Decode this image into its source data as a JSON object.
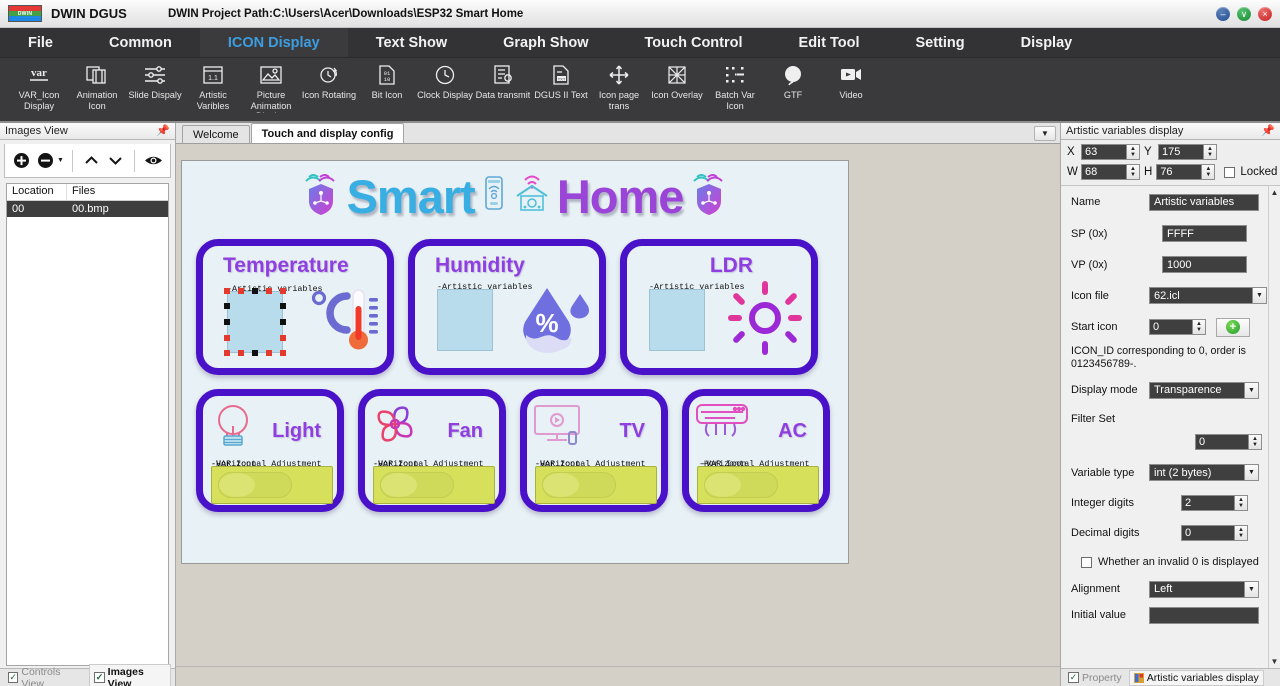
{
  "titlebar": {
    "logo_text": "DWIN",
    "app_name": "DWIN DGUS",
    "project_path": "DWIN Project Path:C:\\Users\\Acer\\Downloads\\ESP32 Smart Home",
    "minimize": "–",
    "maximize": "∨",
    "close": "×"
  },
  "menubar": {
    "items": [
      {
        "label": "File",
        "active": false
      },
      {
        "label": "Common",
        "active": false
      },
      {
        "label": "ICON Display",
        "active": true
      },
      {
        "label": "Text Show",
        "active": false
      },
      {
        "label": "Graph Show",
        "active": false
      },
      {
        "label": "Touch Control",
        "active": false
      },
      {
        "label": "Edit Tool",
        "active": false
      },
      {
        "label": "Setting",
        "active": false
      },
      {
        "label": "Display",
        "active": false
      }
    ],
    "active_color": "#3c9ee0"
  },
  "ribbon": {
    "items": [
      {
        "label": "VAR_Icon Display",
        "icon": "var-text-icon"
      },
      {
        "label": "Animation Icon",
        "icon": "animation-frames-icon"
      },
      {
        "label": "Slide Dispaly",
        "icon": "sliders-icon"
      },
      {
        "label": "Artistic Varibles",
        "icon": "artistic-variable-icon"
      },
      {
        "label": "Picture Animation Display",
        "icon": "picture-animation-icon"
      },
      {
        "label": "Icon Rotating",
        "icon": "icon-rotate-icon"
      },
      {
        "label": "Bit Icon",
        "icon": "bit-icon"
      },
      {
        "label": "Clock Display",
        "icon": "clock-icon"
      },
      {
        "label": "Data transmit",
        "icon": "data-transmit-icon"
      },
      {
        "label": "DGUS II Text",
        "icon": "dgus-text-icon"
      },
      {
        "label": "Icon page trans",
        "icon": "move-arrows-icon"
      },
      {
        "label": "Icon Overlay",
        "icon": "icon-overlay-icon"
      },
      {
        "label": "Batch Var Icon",
        "icon": "batch-var-icon"
      },
      {
        "label": "GTF",
        "icon": "gtf-circle-icon"
      },
      {
        "label": "Video",
        "icon": "video-icon"
      }
    ]
  },
  "left_panel": {
    "title": "Images View",
    "pin_icon": "pin-icon",
    "toolbar": [
      {
        "name": "add-image-button",
        "icon": "plus-circle-icon"
      },
      {
        "name": "remove-image-button",
        "icon": "minus-circle-icon"
      },
      {
        "name": "move-up-button",
        "icon": "chevron-up-icon"
      },
      {
        "name": "move-down-button",
        "icon": "chevron-down-icon"
      },
      {
        "name": "preview-button",
        "icon": "eye-icon"
      }
    ],
    "columns": [
      "Location",
      "Files"
    ],
    "rows": [
      {
        "location": "00",
        "file": "00.bmp",
        "selected": true
      }
    ],
    "status_tabs": [
      {
        "label": "Controls View",
        "checked": true,
        "active": false
      },
      {
        "label": "Images View",
        "checked": true,
        "active": true
      }
    ]
  },
  "center": {
    "tabs": [
      {
        "label": "Welcome",
        "active": false
      },
      {
        "label": "Touch and display config",
        "active": true
      }
    ],
    "tab_dropdown_icon": "chevron-down-icon",
    "canvas": {
      "header": {
        "smart": "Smart",
        "home": "Home"
      },
      "header_icons": [
        "shield-wifi-icon",
        "phone-wifi-icon",
        "smart-house-icon",
        "shield-circuit-icon"
      ],
      "top_cards": [
        {
          "title": "Temperature",
          "var_label": "-Artistic variables",
          "icon": "celsius-thermometer-icon",
          "selected": true
        },
        {
          "title": "Humidity",
          "var_label": "-Artistic variables",
          "icon": "water-drop-percent-icon",
          "selected": false
        },
        {
          "title": "LDR",
          "var_label": "-Artistic variables",
          "icon": "sun-icon",
          "selected": false
        }
      ],
      "bottom_cards": [
        {
          "title": "Light",
          "icon": "lightbulb-icon",
          "var_label_1": "-VAR Icon",
          "var_label_2": "-Horizontal Adjustment"
        },
        {
          "title": "Fan",
          "icon": "fan-icon",
          "var_label_1": "-VAR Icon",
          "var_label_2": "-Horizontal Adjustment"
        },
        {
          "title": "TV",
          "icon": "tv-icon",
          "var_label_1": "-VAR Icon",
          "var_label_2": "-Horizontal Adjustment"
        },
        {
          "title": "AC",
          "icon": "ac-unit-icon",
          "var_label_1": "-VAR Icon",
          "var_label_2": "-Horizontal Adjustment"
        }
      ]
    }
  },
  "right_panel": {
    "title": "Artistic variables display",
    "pin_icon": "pin-icon",
    "geometry": {
      "x_label": "X",
      "x_value": "63",
      "y_label": "Y",
      "y_value": "175",
      "w_label": "W",
      "w_value": "68",
      "h_label": "H",
      "h_value": "76",
      "locked_label": "Locked",
      "locked_checked": false
    },
    "fields": {
      "name_label": "Name",
      "name_value": "Artistic variables",
      "sp_label": "SP (0x)",
      "sp_value": "FFFF",
      "vp_label": "VP (0x)",
      "vp_value": "1000",
      "icon_file_label": "Icon file",
      "icon_file_value": "62.icl",
      "start_icon_label": "Start icon",
      "start_icon_value": "0",
      "add_icon_button": "+",
      "hint": "ICON_ID corresponding to 0, order is 0123456789-.",
      "display_mode_label": "Display mode",
      "display_mode_value": "Transparence",
      "filter_set_label": "Filter Set",
      "filter_set_value": "0",
      "variable_type_label": "Variable type",
      "variable_type_value": "int (2 bytes)",
      "integer_digits_label": "Integer digits",
      "integer_digits_value": "2",
      "decimal_digits_label": "Decimal digits",
      "decimal_digits_value": "0",
      "invalid_zero_label": "Whether an invalid 0 is displayed",
      "invalid_zero_checked": false,
      "alignment_label": "Alignment",
      "alignment_value": "Left",
      "initial_value_label": "Initial value"
    },
    "status_tabs": [
      {
        "label": "Property",
        "checked": true,
        "active": false
      },
      {
        "label": "Artistic variables display",
        "checked": false,
        "active": true
      }
    ]
  }
}
